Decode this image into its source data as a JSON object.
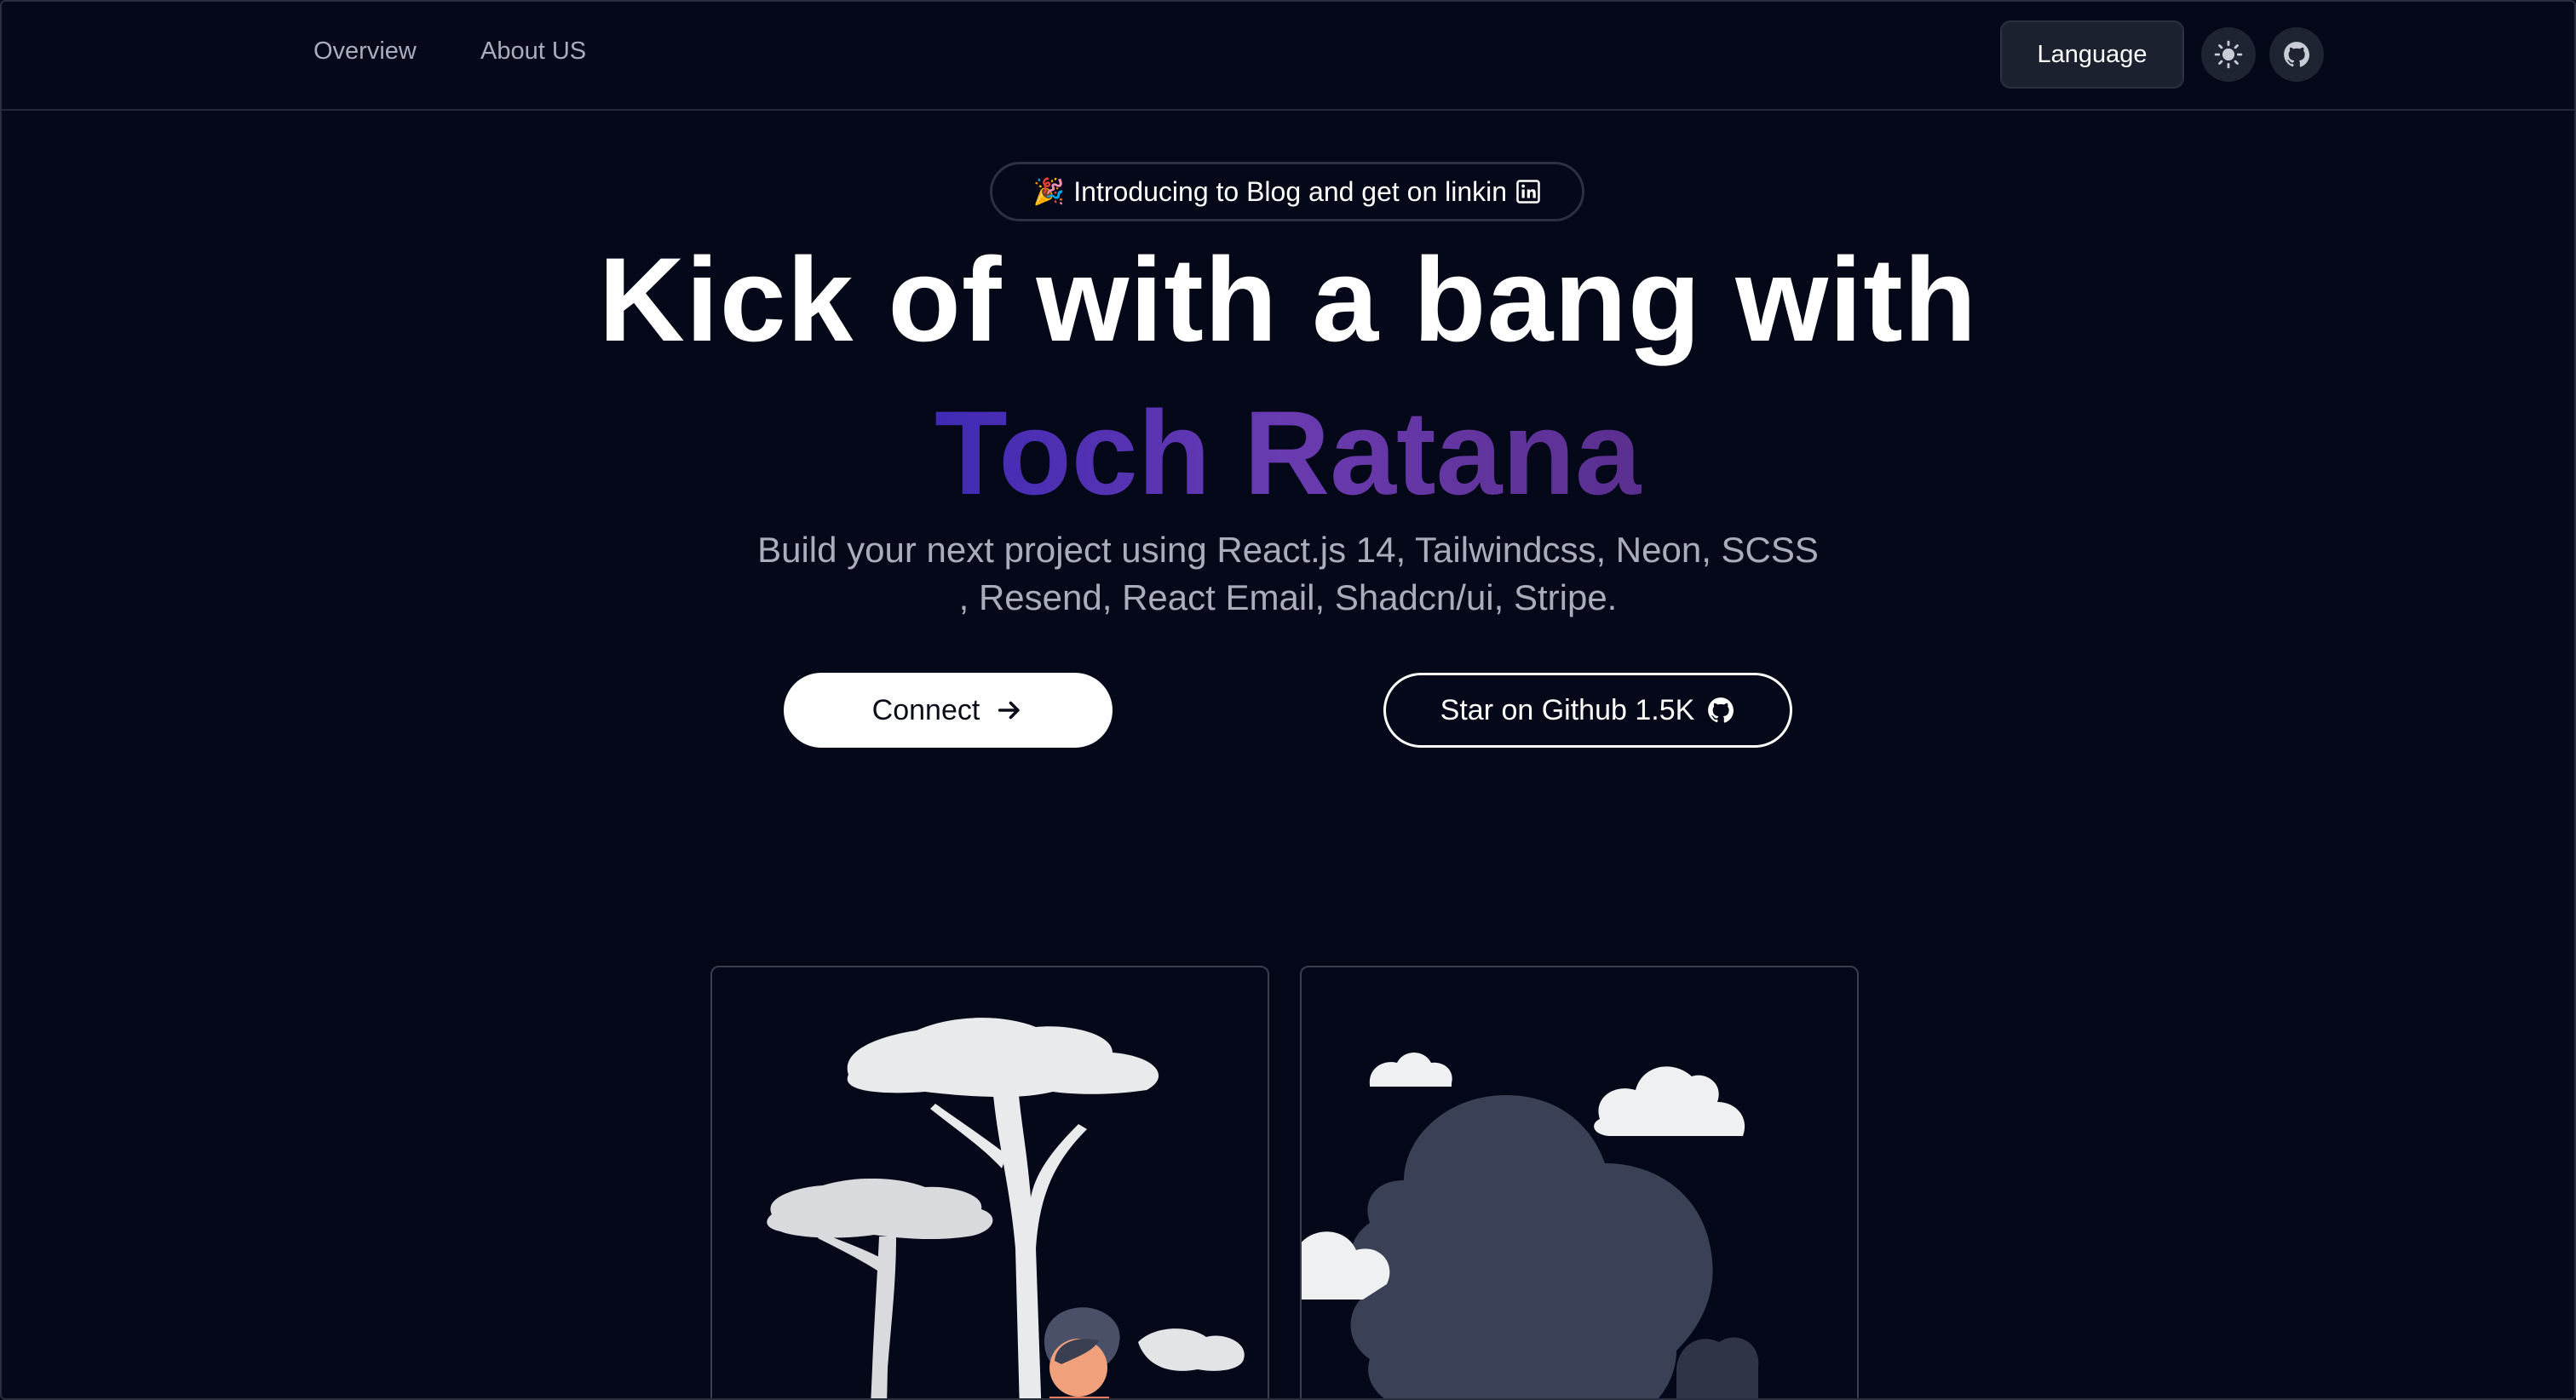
{
  "nav": {
    "links": [
      "Overview",
      "About US"
    ],
    "language_label": "Language",
    "theme_icon": "sun-icon",
    "github_icon": "github-icon"
  },
  "hero": {
    "announcement": "Introducing to Blog and get on linkin",
    "announcement_emoji": "🎉",
    "announcement_icon": "linkedin-icon",
    "title_line1": "Kick of with a bang with",
    "title_name": "Toch Ratana",
    "subtitle": "Build your next project using React.js 14, Tailwindcss, Neon, SCSS , Resend, React Email, Shadcn/ui, Stripe.",
    "connect_label": "Connect",
    "star_label": "Star on Github 1.5K"
  },
  "colors": {
    "background": "#040818",
    "gradient_start": "#3f2ab5",
    "gradient_end": "#5a2f8f",
    "muted_text": "#a9aebb"
  }
}
